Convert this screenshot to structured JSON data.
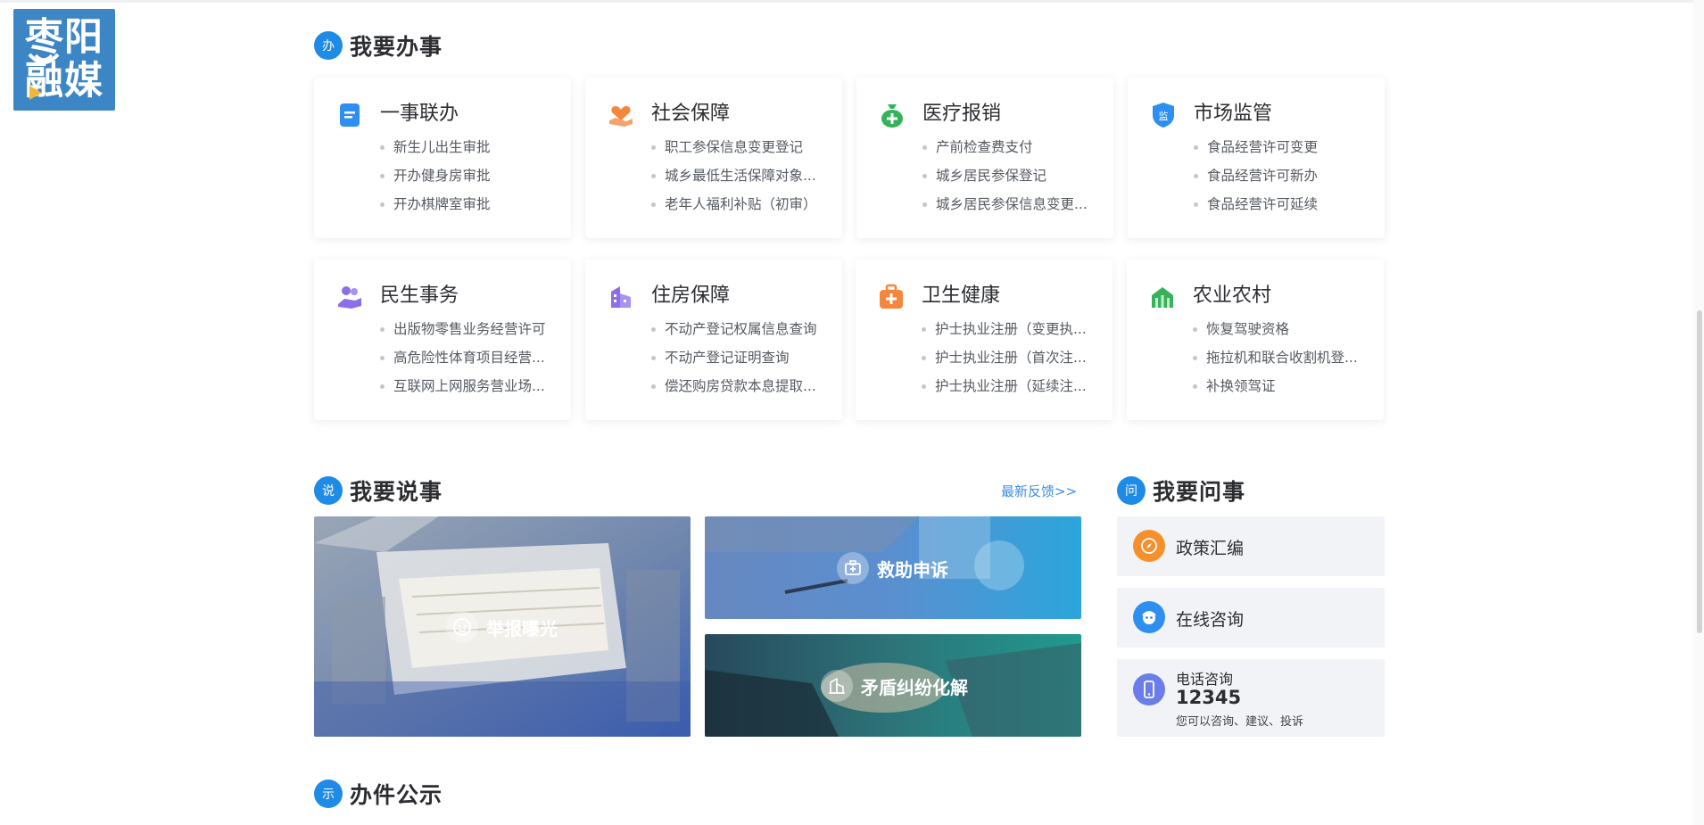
{
  "logo": {
    "line1": "枣阳",
    "line2": "融媒"
  },
  "sections": {
    "banshi": {
      "badge": "办",
      "title": "我要办事"
    },
    "shuoshi": {
      "badge": "说",
      "title": "我要说事",
      "more": "最新反馈>>"
    },
    "wenshi": {
      "badge": "问",
      "title": "我要问事"
    },
    "gongshi": {
      "badge": "示",
      "title": "办件公示"
    }
  },
  "cards": [
    {
      "title": "一事联办",
      "icon": "document-icon",
      "color": "#2f8ff0",
      "items": [
        "新生儿出生审批",
        "开办健身房审批",
        "开办棋牌室审批"
      ]
    },
    {
      "title": "社会保障",
      "icon": "hand-heart-icon",
      "color": "#f5863c",
      "items": [
        "职工参保信息变更登记",
        "城乡最低生活保障对象...",
        "老年人福利补贴（初审）"
      ]
    },
    {
      "title": "医疗报销",
      "icon": "money-bag-icon",
      "color": "#36b35a",
      "items": [
        "产前检查费支付",
        "城乡居民参保登记",
        "城乡居民参保信息变更..."
      ]
    },
    {
      "title": "市场监管",
      "icon": "shield-icon",
      "color": "#2f8ff0",
      "items": [
        "食品经营许可变更",
        "食品经营许可新办",
        "食品经营许可延续"
      ]
    },
    {
      "title": "民生事务",
      "icon": "people-hand-icon",
      "color": "#8b6ee8",
      "items": [
        "出版物零售业务经营许可",
        "高危险性体育项目经营...",
        "互联网上网服务营业场..."
      ]
    },
    {
      "title": "住房保障",
      "icon": "building-icon",
      "color": "#8b6ee8",
      "items": [
        "不动产登记权属信息查询",
        "不动产登记证明查询",
        "偿还购房贷款本息提取..."
      ]
    },
    {
      "title": "卫生健康",
      "icon": "medical-kit-icon",
      "color": "#f5863c",
      "items": [
        "护士执业注册（变更执...",
        "护士执业注册（首次注...",
        "护士执业注册（延续注..."
      ]
    },
    {
      "title": "农业农村",
      "icon": "farm-icon",
      "color": "#36b35a",
      "items": [
        "恢复驾驶资格",
        "拖拉机和联合收割机登...",
        "补换领驾证"
      ]
    }
  ],
  "shuoshi_tiles": {
    "report": "举报曝光",
    "rescue": "救助申诉",
    "mediate": "矛盾纠纷化解"
  },
  "wenshi_items": {
    "policy": "政策汇编",
    "online": "在线咨询",
    "phone_title": "电话咨询",
    "phone_number": "12345",
    "phone_note": "您可以咨询、建议、投诉"
  }
}
